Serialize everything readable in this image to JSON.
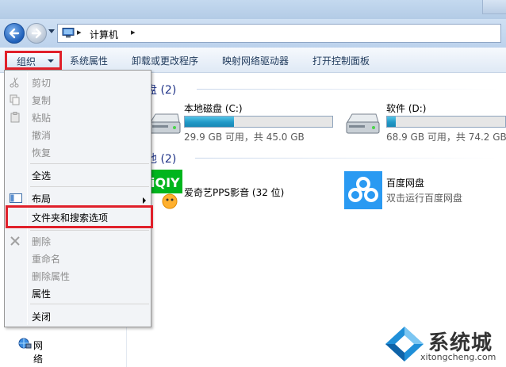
{
  "window": {
    "title": ""
  },
  "address": {
    "crumb": "计算机",
    "sep": "▸"
  },
  "toolbar": {
    "organize": "组织",
    "system_props": "系统属性",
    "uninstall": "卸载或更改程序",
    "map_drive": "映射网络驱动器",
    "control_panel": "打开控制面板"
  },
  "groups": {
    "hdd": "硬盘 (2)",
    "other": "其他 (2)"
  },
  "drives": [
    {
      "name": "本地磁盘 (C:)",
      "size": "29.9 GB 可用，共 45.0 GB",
      "used_fraction": 0.336
    },
    {
      "name": "软件 (D:)",
      "size": "68.9 GB 可用，共 74.2 GB",
      "used_fraction": 0.071
    }
  ],
  "apps": [
    {
      "name": "爱奇艺PPS影音 (32 位)",
      "desc": ""
    },
    {
      "name": "百度网盘",
      "desc": "双击运行百度网盘"
    }
  ],
  "navpane": {
    "network": "网络"
  },
  "menu": {
    "cut": "剪切",
    "copy": "复制",
    "paste": "粘贴",
    "undo": "撤消",
    "redo": "恢复",
    "select_all": "全选",
    "layout": "布局",
    "folder_options": "文件夹和搜索选项",
    "delete": "删除",
    "rename": "重命名",
    "remove_props": "删除属性",
    "properties": "属性",
    "close": "关闭"
  },
  "watermark": {
    "brand": "系统城",
    "url": "xitongcheng.com"
  },
  "colors": {
    "accent_red": "#e0202a",
    "header_blue": "#1e3287",
    "bar_fill": "#2299c7"
  }
}
